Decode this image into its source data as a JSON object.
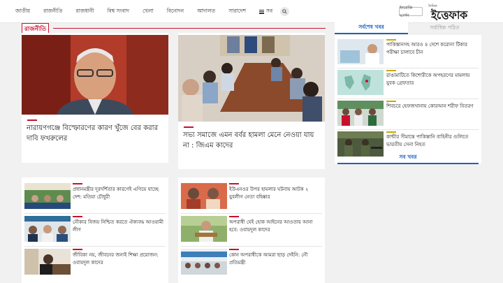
{
  "nav": {
    "items": [
      "জাতীয়",
      "রাজনীতি",
      "রাজধানী",
      "বিশ্ব সংবাদ",
      "খেলা",
      "বিনোদন",
      "আদালত",
      "সারাদেশ"
    ],
    "more_label": "সব"
  },
  "header": {
    "english_label": "ইংরেজি ভার্সন",
    "logo_small": "দৈনিক",
    "logo_text": "ইত্তেফাক"
  },
  "section": {
    "title": "রাজনীতি"
  },
  "leads": [
    {
      "title": "নারায়ণগঞ্জে বিস্ফোরণের কারণ খুঁজে বের করার দাবি ফখরুলের"
    },
    {
      "title": "সভ্য সমাজে এমন বর্বর হামলা মেনে নেওয়া যায় না : জিএম কাদের"
    }
  ],
  "grid_left": [
    {
      "title": "প্রধানমন্ত্রীর দূরদর্শিতার কারণেই এগিয়ে যাচ্ছে দেশ: মতিয়া চৌধুরী"
    },
    {
      "title": "নৌকার বিজয় নিশ্চিত করতে ঐক্যবদ্ধ আওয়ামী লীগ"
    },
    {
      "title": "জীবিকা নয়, জীবনের জন্যই শিক্ষা প্রয়োজন: ওবায়দুল কাদের"
    }
  ],
  "grid_right": [
    {
      "title": "ইউএনওর উপর হামলার ঘটনায় আটক ২ যুবলীগ নেতা বহিষ্কার"
    },
    {
      "title": "অপরাধী যেই হোক আইনের আওতায় আনা হবে: ওবায়দুল কাদের"
    },
    {
      "title": "কোন অপরাধীকে আমরা ছাড় দেইনি: নৌ প্রতিমন্ত্রী"
    }
  ],
  "sidebar": {
    "tabs": [
      "সর্বশেষ খবর",
      "সর্বাধিক পঠিত"
    ],
    "items": [
      {
        "title": "পাকিস্তানসহ আরও ৪ দেশে করোনা টিকার পরীক্ষা চালাবে চীন"
      },
      {
        "title": "রাঙামাটিতে কিশোরীকে অপহরণের মামলায় যুবক গ্রেফতার"
      },
      {
        "title": "শিবচরে হেফজখানায় কোরআন শরীফ বিতরণ"
      },
      {
        "title": "কাশ্মীর সীমান্তে পাকিস্তানি বাহিনীর গুলিতে ভারতীয় সেনা নিহত"
      }
    ],
    "all_news_label": "সব খবর"
  },
  "colors": {
    "accent_red": "#c8102e",
    "accent_blue": "#1f5fbf",
    "accent_gold": "#c8a800"
  }
}
